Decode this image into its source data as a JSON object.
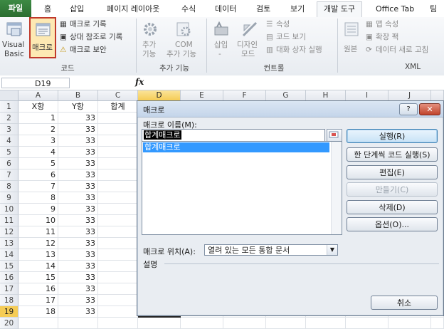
{
  "ribbon_tabs": [
    "파일",
    "홈",
    "삽입",
    "페이지 레이아웃",
    "수식",
    "데이터",
    "검토",
    "보기",
    "개발 도구",
    "Office Tab",
    "팀"
  ],
  "ribbon": {
    "code_group": {
      "label": "코드",
      "visual_basic": [
        "Visual",
        "Basic"
      ],
      "macros": "매크로",
      "record_macro": "매크로 기록",
      "relative_ref": "상대 참조로 기록",
      "macro_security": "매크로 보안"
    },
    "addins_group": {
      "label": "추가 기능",
      "addins": [
        "추가",
        "기능"
      ],
      "com_addins": [
        "COM",
        "추가 기능"
      ]
    },
    "controls_group": {
      "label": "컨트롤",
      "insert": [
        "삽입",
        "-"
      ],
      "design_mode": [
        "디자인",
        "모드"
      ],
      "properties": "속성",
      "view_code": "코드 보기",
      "run_dialog": "대화 상자 실행"
    },
    "xml_group": {
      "label": "XML",
      "source": "원본",
      "map_properties": "맵 속성",
      "expansion_packs": "확장 팩",
      "refresh_data": "데이터 새로 고침"
    }
  },
  "formula_bar": {
    "name_box": "D19",
    "fx": "fx",
    "value": ""
  },
  "sheet": {
    "columns": [
      "A",
      "B",
      "C",
      "D",
      "E",
      "F",
      "G",
      "H",
      "I",
      "J"
    ],
    "rows": [
      "1",
      "2",
      "3",
      "4",
      "5",
      "6",
      "7",
      "8",
      "9",
      "10",
      "11",
      "12",
      "13",
      "14",
      "15",
      "16",
      "17",
      "18",
      "19",
      "20"
    ],
    "header_row": {
      "a": "X항",
      "b": "Y항",
      "c": "합계"
    },
    "data": [
      [
        "1",
        "33"
      ],
      [
        "2",
        "33"
      ],
      [
        "3",
        "33"
      ],
      [
        "4",
        "33"
      ],
      [
        "5",
        "33"
      ],
      [
        "6",
        "33"
      ],
      [
        "7",
        "33"
      ],
      [
        "8",
        "33"
      ],
      [
        "9",
        "33"
      ],
      [
        "10",
        "33"
      ],
      [
        "11",
        "33"
      ],
      [
        "12",
        "33"
      ],
      [
        "13",
        "33"
      ],
      [
        "14",
        "33"
      ],
      [
        "15",
        "33"
      ],
      [
        "16",
        "33"
      ],
      [
        "17",
        "33"
      ],
      [
        "18",
        "33"
      ]
    ]
  },
  "dialog": {
    "title": "매크로",
    "help": "?",
    "close": "✕",
    "name_label": "매크로 이름(M):",
    "name_value": "합계매크로",
    "list_items": [
      "합계매크로"
    ],
    "buttons": {
      "run": "실행(R)",
      "step_into": "한 단계씩 코드 실행(S)",
      "edit": "편집(E)",
      "create": "만들기(C)",
      "delete": "삭제(D)",
      "options": "옵션(O)...",
      "cancel": "취소"
    },
    "location_label": "매크로 위치(A):",
    "location_value": "열려 있는 모든 통합 문서",
    "description_label": "설명"
  }
}
